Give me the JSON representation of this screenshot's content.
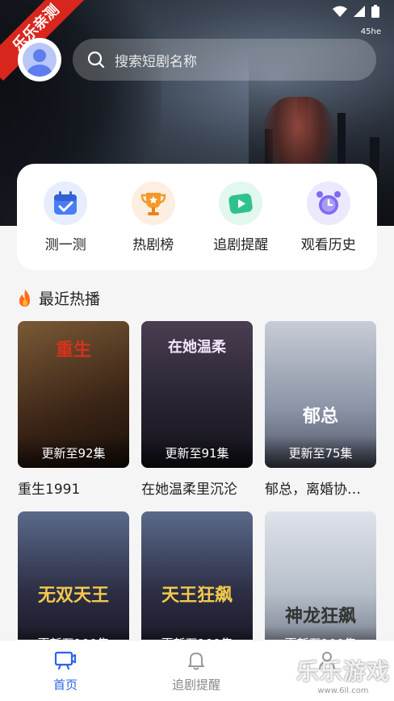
{
  "status": {
    "network_label": "45he"
  },
  "ribbon": {
    "text": "乐乐亲测"
  },
  "search": {
    "placeholder": "搜索短剧名称"
  },
  "actions": [
    {
      "label": "测一测",
      "icon": "calendar-check-icon",
      "color": "#4a7cf6"
    },
    {
      "label": "热剧榜",
      "icon": "trophy-icon",
      "color": "#f59a2a"
    },
    {
      "label": "追剧提醒",
      "icon": "play-tv-icon",
      "color": "#2fc38c"
    },
    {
      "label": "观看历史",
      "icon": "alarm-clock-icon",
      "color": "#7d6bf2"
    }
  ],
  "section": {
    "title": "最近热播",
    "icon": "fire-icon"
  },
  "dramas": [
    {
      "title": "重生1991",
      "badge": "更新至92集",
      "art": "重生",
      "bg": "#5a3a22"
    },
    {
      "title": "在她温柔里沉沦",
      "badge": "更新至91集",
      "art": "在她温柔",
      "bg": "#2c2a3a"
    },
    {
      "title": "郁总，离婚协…",
      "badge": "更新至75集",
      "art": "郁总",
      "bg": "#8a94a6"
    },
    {
      "title": "",
      "badge": "更新至100集",
      "art": "无双天王",
      "bg": "#2d2e44"
    },
    {
      "title": "",
      "badge": "更新至100集",
      "art": "天王狂飙",
      "bg": "#2d2e44"
    },
    {
      "title": "",
      "badge": "更新至100集",
      "art": "神龙狂飙",
      "bg": "#b6bfca"
    }
  ],
  "nav": [
    {
      "label": "首页",
      "icon": "tv-home-icon",
      "active": true
    },
    {
      "label": "追剧提醒",
      "icon": "bell-icon",
      "active": false
    },
    {
      "label": "",
      "icon": "user-icon",
      "active": false
    }
  ],
  "watermark": {
    "main": "乐乐游戏",
    "sub": "www.6ll.com"
  },
  "colors": {
    "accent": "#2d63e8",
    "ribbon": "#d9261c"
  }
}
